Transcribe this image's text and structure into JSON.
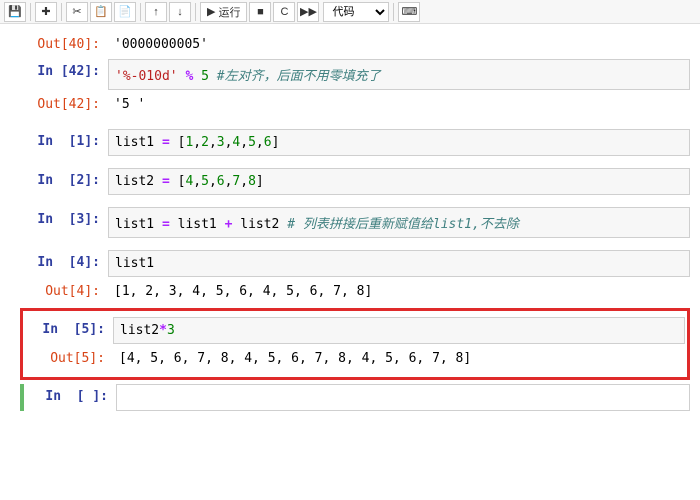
{
  "toolbar": {
    "run_label": "运行",
    "celltype": "代码"
  },
  "cells": {
    "out40_prompt": "Out[40]:",
    "out40_body": "'0000000005'",
    "in42_prompt": "In [42]:",
    "in42_str": "'%-010d'",
    "in42_op": "%",
    "in42_num": "5",
    "in42_cmt": "#左对齐，后面不用零填充了",
    "out42_prompt": "Out[42]:",
    "out42_body": "'5         '",
    "in1_prompt": "In  [1]:",
    "in1_a": "list1 ",
    "in1_eq": "=",
    "in1_b": " [",
    "in1_n1": "1",
    "in1_n2": "2",
    "in1_n3": "3",
    "in1_n4": "4",
    "in1_n5": "5",
    "in1_n6": "6",
    "in1_c": "]",
    "in2_prompt": "In  [2]:",
    "in2_a": "list2 ",
    "in2_eq": "=",
    "in2_b": " [",
    "in2_n1": "4",
    "in2_n2": "5",
    "in2_n3": "6",
    "in2_n4": "7",
    "in2_n5": "8",
    "in2_c": "]",
    "in3_prompt": "In  [3]:",
    "in3_a": "list1 ",
    "in3_eq1": "=",
    "in3_b": " list1 ",
    "in3_plus": "+",
    "in3_c": " list2  ",
    "in3_cmt": "# 列表拼接后重新赋值给list1,不去除",
    "in4_prompt": "In  [4]:",
    "in4_body": "list1",
    "out4_prompt": "Out[4]:",
    "out4_body": "[1, 2, 3, 4, 5, 6, 4, 5, 6, 7, 8]",
    "in5_prompt": "In  [5]:",
    "in5_a": "list2",
    "in5_star": "*",
    "in5_n": "3",
    "out5_prompt": "Out[5]:",
    "out5_body": "[4, 5, 6, 7, 8, 4, 5, 6, 7, 8, 4, 5, 6, 7, 8]",
    "inblank_prompt": "In  [ ]:"
  }
}
